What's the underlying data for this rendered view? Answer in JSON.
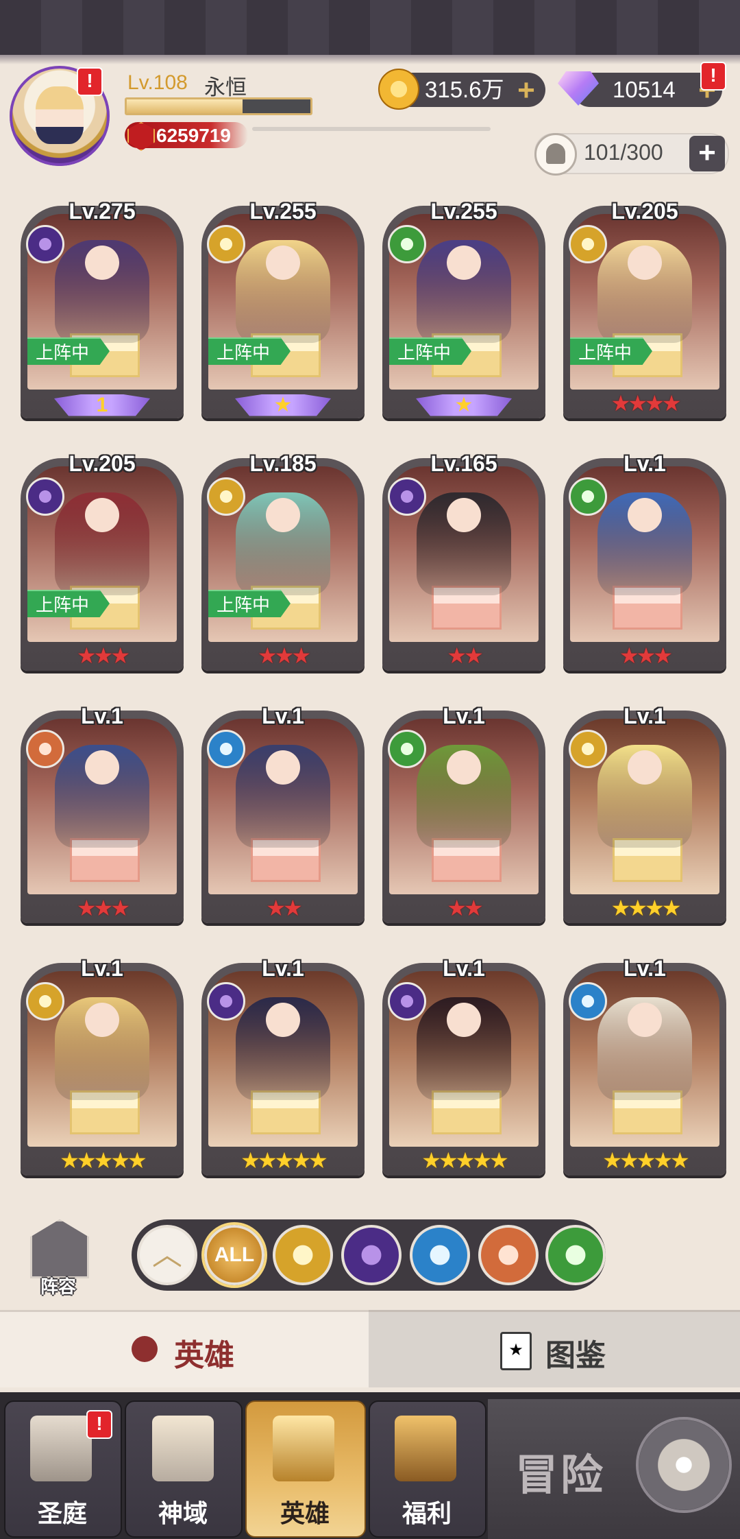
{
  "header": {
    "level": "Lv.108",
    "player_name": "永恒",
    "xp_progress": 0.63,
    "power": "6259719",
    "avatar_badge": "!",
    "gold": "315.6万",
    "gems": "10514",
    "gem_badge": "!",
    "roster": "101/300",
    "plus": "+"
  },
  "heroes": [
    {
      "level": "Lv.275",
      "faction": "dark",
      "deployed": true,
      "deploy_label": "上阵中",
      "rank": "purple-1",
      "rank_label": "1",
      "stars": 0
    },
    {
      "level": "Lv.255",
      "faction": "light",
      "deployed": true,
      "deploy_label": "上阵中",
      "rank": "purple-star",
      "rank_label": "★",
      "stars": 0
    },
    {
      "level": "Lv.255",
      "faction": "nature",
      "deployed": true,
      "deploy_label": "上阵中",
      "rank": "purple-star",
      "rank_label": "★",
      "stars": 0
    },
    {
      "level": "Lv.205",
      "faction": "light",
      "deployed": true,
      "deploy_label": "上阵中",
      "rank": "red",
      "stars": 4
    },
    {
      "level": "Lv.205",
      "faction": "dark",
      "deployed": true,
      "deploy_label": "上阵中",
      "rank": "red",
      "stars": 3
    },
    {
      "level": "Lv.185",
      "faction": "light",
      "deployed": true,
      "deploy_label": "上阵中",
      "rank": "red",
      "stars": 3
    },
    {
      "level": "Lv.165",
      "faction": "dark",
      "deployed": false,
      "rank": "red",
      "stars": 2
    },
    {
      "level": "Lv.1",
      "faction": "nature",
      "deployed": false,
      "rank": "red",
      "stars": 3
    },
    {
      "level": "Lv.1",
      "faction": "beast",
      "deployed": false,
      "rank": "red",
      "stars": 3
    },
    {
      "level": "Lv.1",
      "faction": "water",
      "deployed": false,
      "rank": "red",
      "stars": 2
    },
    {
      "level": "Lv.1",
      "faction": "nature",
      "deployed": false,
      "rank": "red",
      "stars": 2
    },
    {
      "level": "Lv.1",
      "faction": "light",
      "deployed": false,
      "rank": "gold",
      "stars": 4
    },
    {
      "level": "Lv.1",
      "faction": "light",
      "deployed": false,
      "rank": "gold",
      "stars": 5
    },
    {
      "level": "Lv.1",
      "faction": "dark",
      "deployed": false,
      "rank": "gold",
      "stars": 5
    },
    {
      "level": "Lv.1",
      "faction": "dark",
      "deployed": false,
      "rank": "gold",
      "stars": 5
    },
    {
      "level": "Lv.1",
      "faction": "water",
      "deployed": false,
      "rank": "gold",
      "stars": 5
    }
  ],
  "filters": {
    "lineup_label": "阵容",
    "all_label": "ALL",
    "up_label": "︿",
    "factions": [
      "light-icon",
      "dark-icon",
      "water-icon",
      "beast-icon",
      "nature-icon"
    ]
  },
  "tabs": {
    "heroes": "英雄",
    "codex": "图鉴",
    "codex_icon": "★"
  },
  "nav": {
    "items": [
      "圣庭",
      "神域",
      "英雄",
      "福利"
    ],
    "active": "英雄",
    "sanctuary_badge": "!",
    "adventure": "冒险"
  },
  "colors": {
    "deploy_green": "#33a853",
    "star_red": "#e23a3a",
    "star_gold": "#ffd02a",
    "active_nav": "#e9bc6a"
  }
}
